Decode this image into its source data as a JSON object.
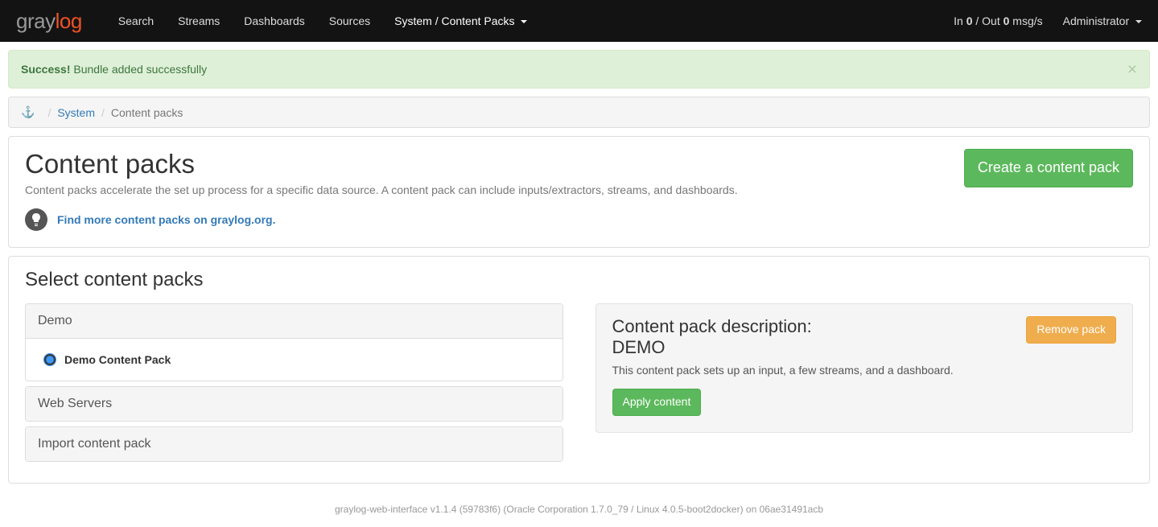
{
  "brand": {
    "left": "gray",
    "right": "log"
  },
  "nav": {
    "items": [
      "Search",
      "Streams",
      "Dashboards",
      "Sources",
      "System / Content Packs"
    ],
    "status_prefix": "In ",
    "status_in": "0",
    "status_mid": " / Out ",
    "status_out": "0",
    "status_suffix": " msg/s",
    "admin": "Administrator"
  },
  "alert": {
    "strong": "Success!",
    "text": " Bundle added successfully"
  },
  "breadcrumb": {
    "system": "System",
    "current": "Content packs"
  },
  "page": {
    "title": "Content packs",
    "subtitle": "Content packs accelerate the set up process for a specific data source. A content pack can include inputs/extractors, streams, and dashboards.",
    "hint": "Find more content packs on graylog.org.",
    "create_btn": "Create a content pack"
  },
  "select": {
    "title": "Select content packs",
    "groups": [
      {
        "label": "Demo",
        "items": [
          "Demo Content Pack"
        ],
        "expanded": true
      },
      {
        "label": "Web Servers",
        "items": [],
        "expanded": false
      },
      {
        "label": "Import content pack",
        "items": [],
        "expanded": false
      }
    ]
  },
  "desc": {
    "heading": "Content pack description:",
    "name": "DEMO",
    "text": "This content pack sets up an input, a few streams, and a dashboard.",
    "remove_btn": "Remove pack",
    "apply_btn": "Apply content"
  },
  "footer": "graylog-web-interface v1.1.4 (59783f6) (Oracle Corporation 1.7.0_79 / Linux 4.0.5-boot2docker) on 06ae31491acb"
}
